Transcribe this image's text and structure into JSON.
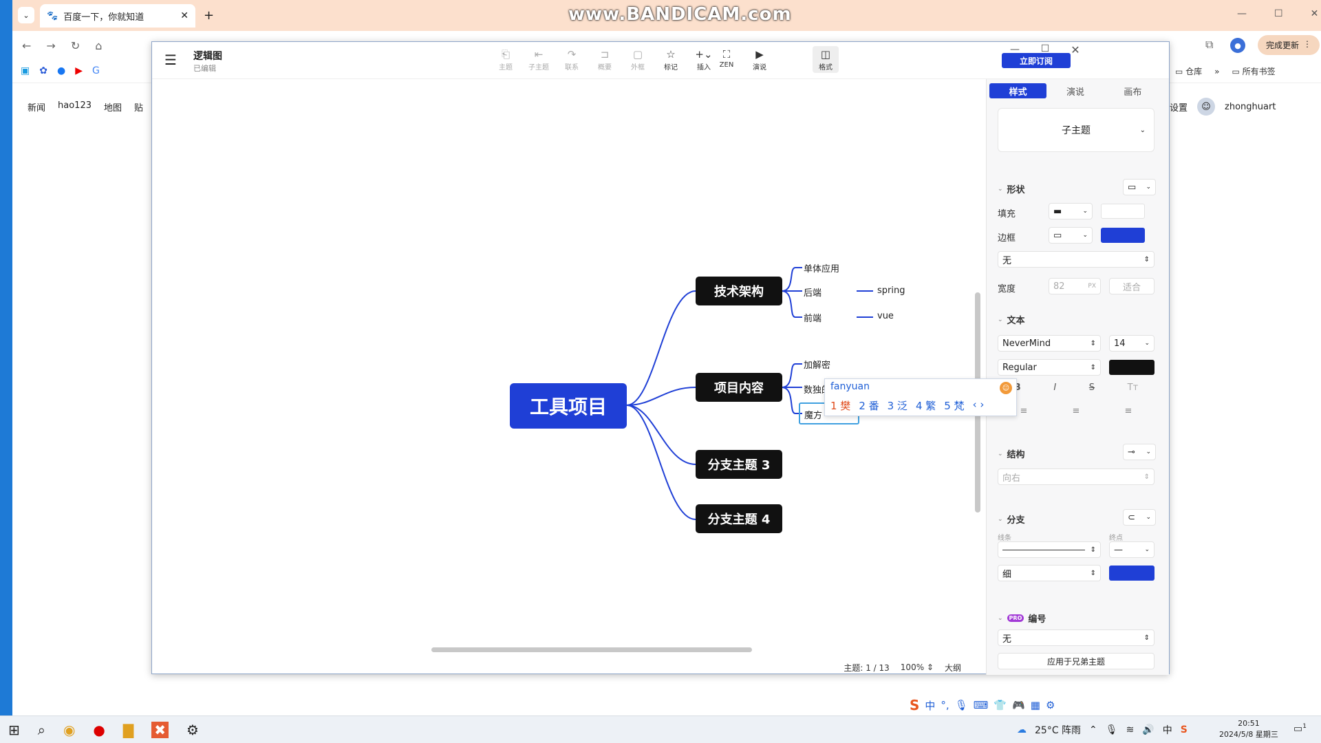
{
  "browser": {
    "tab_title": "百度一下，你就知道",
    "bookmarks_right": [
      "仓库",
      "所有书签"
    ],
    "update_button": "完成更新",
    "watermark": "www.BANDICAM.com"
  },
  "baidu": {
    "nav": [
      "新闻",
      "hao123",
      "地图",
      "贴"
    ],
    "settings": "设置",
    "username": "zhonghuart"
  },
  "app": {
    "title": "逻辑图",
    "subtitle": "已编辑",
    "toolbar": [
      {
        "label": "主题",
        "icon": "topic-icon",
        "enabled": false
      },
      {
        "label": "子主题",
        "icon": "subtopic-icon",
        "enabled": false
      },
      {
        "label": "联系",
        "icon": "relation-icon",
        "enabled": false
      },
      {
        "label": "概要",
        "icon": "summary-icon",
        "enabled": false
      },
      {
        "label": "外框",
        "icon": "boundary-icon",
        "enabled": false
      },
      {
        "label": "标记",
        "icon": "star-icon",
        "enabled": true
      },
      {
        "label": "插入",
        "icon": "plus-icon",
        "enabled": true
      }
    ],
    "zen": "ZEN",
    "present": "演说",
    "format": "格式",
    "subscribe": "立即订阅"
  },
  "mindmap": {
    "root": "工具项目",
    "branches": [
      {
        "label": "技术架构",
        "children": [
          {
            "label": "单体应用",
            "children": []
          },
          {
            "label": "后端",
            "children": [
              "spring"
            ]
          },
          {
            "label": "前端",
            "children": [
              "vue"
            ]
          }
        ]
      },
      {
        "label": "项目内容",
        "children": [
          {
            "label": "加解密",
            "children": []
          },
          {
            "label": "数独的解法",
            "children": []
          },
          {
            "label": "魔方",
            "children": []
          }
        ]
      },
      {
        "label": "分支主题 3",
        "children": []
      },
      {
        "label": "分支主题 4",
        "children": []
      }
    ]
  },
  "ime": {
    "composition": "fanyuan",
    "candidates": [
      "1 樊",
      "2 番",
      "3 泛",
      "4 繁",
      "5 梵"
    ]
  },
  "panel": {
    "tabs": [
      "样式",
      "演说",
      "画布"
    ],
    "active_tab": "样式",
    "style_preview": "子主题",
    "shape_section": "形状",
    "fill_label": "填充",
    "border_label": "边框",
    "border_option": "无",
    "width_label": "宽度",
    "width_value": "82",
    "width_unit": "PX",
    "fit_button": "适合",
    "text_section": "文本",
    "font": "NeverMind",
    "font_size": "14",
    "font_weight": "Regular",
    "structure_section": "结构",
    "structure_value": "向右",
    "branch_section": "分支",
    "line_label": "线条",
    "endpoint_label": "终点",
    "thickness": "细",
    "numbering_section": "编号",
    "pro_badge": "PRO",
    "numbering_value": "无",
    "apply_button": "应用于兄弟主题",
    "accent": "#1f3fd6"
  },
  "status": {
    "topic_count": "主题: 1 / 13",
    "zoom": "100%",
    "outline": "大纲"
  },
  "taskbar": {
    "weather": "25°C 阵雨",
    "ime_mode": "中",
    "time": "20:51",
    "date": "2024/5/8 星期三",
    "notif": "1"
  }
}
